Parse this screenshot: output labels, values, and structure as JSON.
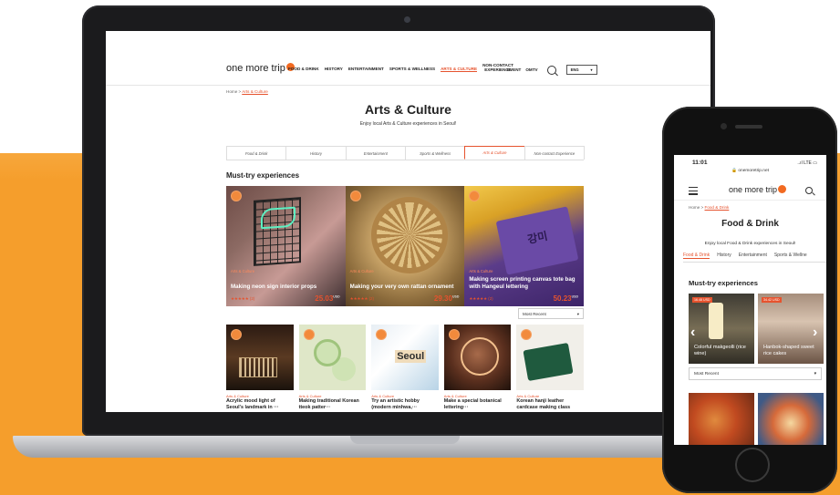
{
  "desktop": {
    "logo": "one more trip",
    "nav": [
      {
        "label": "FOOD & DRINK",
        "active": false
      },
      {
        "label": "HISTORY",
        "active": false
      },
      {
        "label": "ENTERTAINMENT",
        "active": false
      },
      {
        "label": "SPORTS & WELLNESS",
        "active": false
      },
      {
        "label": "ARTS & CULTURE",
        "active": true
      }
    ],
    "nav_noncontact_line1": "NON-CONTACT",
    "nav_noncontact_line2": "EXPERIENCE",
    "nav_event": "EVENT",
    "nav_omtv": "OMTV",
    "lang": "ENG",
    "breadcrumb_home": "Home",
    "breadcrumb_sep": ">",
    "breadcrumb_current": "Arts & Culture",
    "title": "Arts & Culture",
    "subtitle": "Enjoy local Arts & Culture experiences in Seoul!",
    "tabs": [
      "Food & Drink",
      "History",
      "Entertainment",
      "Sports & Wellness",
      "Arts & Culture",
      "Non-contact Experience"
    ],
    "section_title": "Must-try experiences",
    "big_cards": [
      {
        "category": "Arts & Culture",
        "title": "Making neon sign interior props",
        "stars": "★★★★★ (2)",
        "price": "25.03"
      },
      {
        "category": "Arts & Culture",
        "title": "Making your very own rattan ornament",
        "stars": "★★★★★ (2)",
        "price": "29.30"
      },
      {
        "category": "Arts & Culture",
        "title": "Making screen printing canvas tote bag with Hangeul lettering",
        "stars": "★★★★★ (2)",
        "price": "50.23"
      }
    ],
    "price_unit": "USD",
    "sort": "Most Recent",
    "small_cards": [
      {
        "category": "Arts & Culture",
        "title": "Acrylic mood light of Seoul's landmark in ···"
      },
      {
        "category": "Arts & Culture",
        "title": "Making traditional Korean tteok patter···"
      },
      {
        "category": "Arts & Culture",
        "title": "Try an artistic hobby (modern minhwa,···"
      },
      {
        "category": "Arts & Culture",
        "title": "Make a special botanical lettering···"
      },
      {
        "category": "Arts & Culture",
        "title": "Korean hanji leather cardcase making class"
      }
    ]
  },
  "mobile": {
    "time": "11:01",
    "signal": "..ıl LTE ▭",
    "url": "🔒 onemoretrip.net",
    "logo": "one more trip",
    "breadcrumb_home": "Home",
    "breadcrumb_sep": ">",
    "breadcrumb_current": "Food & Drink",
    "title": "Food & Drink",
    "subtitle": "Enjoy local Food & Drink experiences in Seoul!",
    "tabs": [
      {
        "label": "Food & Drink",
        "active": true
      },
      {
        "label": "History",
        "active": false
      },
      {
        "label": "Entertainment",
        "active": false
      },
      {
        "label": "Sports & Wellne",
        "active": false
      }
    ],
    "section_title": "Must-try experiences",
    "cards": [
      {
        "price_tag": "16.48 USD",
        "title": "Colorful makgeolli (rice wine)"
      },
      {
        "price_tag": "34.42 USD",
        "title": "Hanbok-shaped sweet rice cakes"
      }
    ],
    "arrow_left": "‹",
    "arrow_right": "›",
    "sort": "Most Recent"
  },
  "icons": [
    "search-icon",
    "menu-icon",
    "chevron-down-icon",
    "sun-logo-icon",
    "camera-icon"
  ],
  "colors": {
    "accent": "#e6532e",
    "background_band": "#f59e2c",
    "device": "#1b1b1d"
  }
}
